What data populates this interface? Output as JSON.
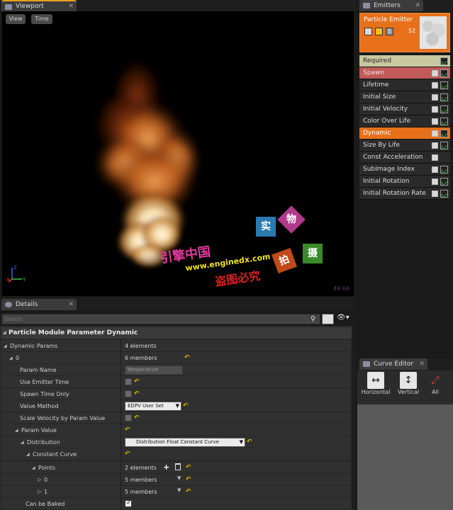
{
  "viewport": {
    "tab_label": "Viewport",
    "view_button": "View",
    "time_button": "Time",
    "fps_readout": "49.66",
    "gizmo_x": "X",
    "gizmo_y": "Y",
    "gizmo_z": "Z"
  },
  "watermark": {
    "line1": "引擎中国",
    "line2": "www.enginedx.com",
    "line3": "盗图必究",
    "badges": [
      "实",
      "物",
      "拍",
      "摄"
    ]
  },
  "emitters": {
    "tab_label": "Emitters",
    "emitter_name": "Particle Emitter",
    "emitter_badge": "S",
    "particle_count": "52",
    "modules": [
      {
        "label": "Required",
        "state": "required",
        "checkbox": false,
        "graph": true
      },
      {
        "label": "Spawn",
        "state": "spawn",
        "checkbox": true,
        "graph": true
      },
      {
        "label": "Lifetime",
        "state": "normal",
        "checkbox": true,
        "graph": true
      },
      {
        "label": "Initial Size",
        "state": "normal",
        "checkbox": true,
        "graph": true
      },
      {
        "label": "Initial Velocity",
        "state": "normal",
        "checkbox": true,
        "graph": true
      },
      {
        "label": "Color Over Life",
        "state": "normal",
        "checkbox": true,
        "graph": true
      },
      {
        "label": "Dynamic",
        "state": "dynamic",
        "checkbox": true,
        "graph": true
      },
      {
        "label": "Size By Life",
        "state": "normal",
        "checkbox": true,
        "graph": true
      },
      {
        "label": "Const Acceleration",
        "state": "normal",
        "checkbox": true,
        "graph": false
      },
      {
        "label": "SubImage Index",
        "state": "normal",
        "checkbox": true,
        "graph": true
      },
      {
        "label": "Initial Rotation",
        "state": "normal",
        "checkbox": true,
        "graph": true
      },
      {
        "label": "Initial Rotation Rate",
        "state": "normal",
        "checkbox": true,
        "graph": true
      }
    ]
  },
  "curve_editor": {
    "tab_label": "Curve Editor",
    "buttons": [
      {
        "label": "Horizontal",
        "icon": "fit-horizontal-icon"
      },
      {
        "label": "Vertical",
        "icon": "fit-vertical-icon"
      },
      {
        "label": "All",
        "icon": "fit-all-icon"
      }
    ]
  },
  "details": {
    "tab_label": "Details",
    "search_placeholder": "Search",
    "category_title": "Particle Module Parameter Dynamic",
    "rows": [
      {
        "name": "Dynamic Params",
        "indent": 0,
        "arrow": "expanded",
        "value": "4 elements",
        "type": "text"
      },
      {
        "name": "0",
        "indent": 1,
        "arrow": "expanded",
        "value": "6 members",
        "type": "text",
        "reset": true
      },
      {
        "name": "Param Name",
        "indent": 2,
        "arrow": "none",
        "value": "Temperature",
        "type": "input"
      },
      {
        "name": "Use Emitter Time",
        "indent": 2,
        "arrow": "none",
        "value": "",
        "type": "checkbox",
        "checked": false,
        "reset": true
      },
      {
        "name": "Spawn Time Only",
        "indent": 2,
        "arrow": "none",
        "value": "",
        "type": "checkbox",
        "checked": false,
        "reset": true
      },
      {
        "name": "Value Method",
        "indent": 2,
        "arrow": "none",
        "value": "EDPV User Set",
        "type": "combo",
        "reset": true
      },
      {
        "name": "Scale Velocity by Param Value",
        "indent": 2,
        "arrow": "none",
        "value": "",
        "type": "checkbox",
        "checked": false,
        "reset": true
      },
      {
        "name": "Param Value",
        "indent": 2,
        "arrow": "expanded",
        "value": "",
        "type": "text",
        "reset": true
      },
      {
        "name": "Distribution",
        "indent": 3,
        "arrow": "expanded",
        "value": "Distribution Float Constant Curve",
        "type": "combo-wide",
        "reset": true
      },
      {
        "name": "Constant Curve",
        "indent": 4,
        "arrow": "expanded",
        "value": "",
        "type": "text",
        "reset": true
      },
      {
        "name": "Points",
        "indent": 5,
        "arrow": "expanded",
        "value": "2 elements",
        "type": "array",
        "reset": true
      },
      {
        "name": "0",
        "indent": 6,
        "arrow": "collapsed",
        "value": "5 members",
        "type": "member",
        "reset": true
      },
      {
        "name": "1",
        "indent": 6,
        "arrow": "collapsed",
        "value": "5 members",
        "type": "member",
        "reset": true
      },
      {
        "name": "Can be Baked",
        "indent": 3,
        "arrow": "none",
        "value": "",
        "type": "checkbox",
        "checked": true
      }
    ]
  }
}
